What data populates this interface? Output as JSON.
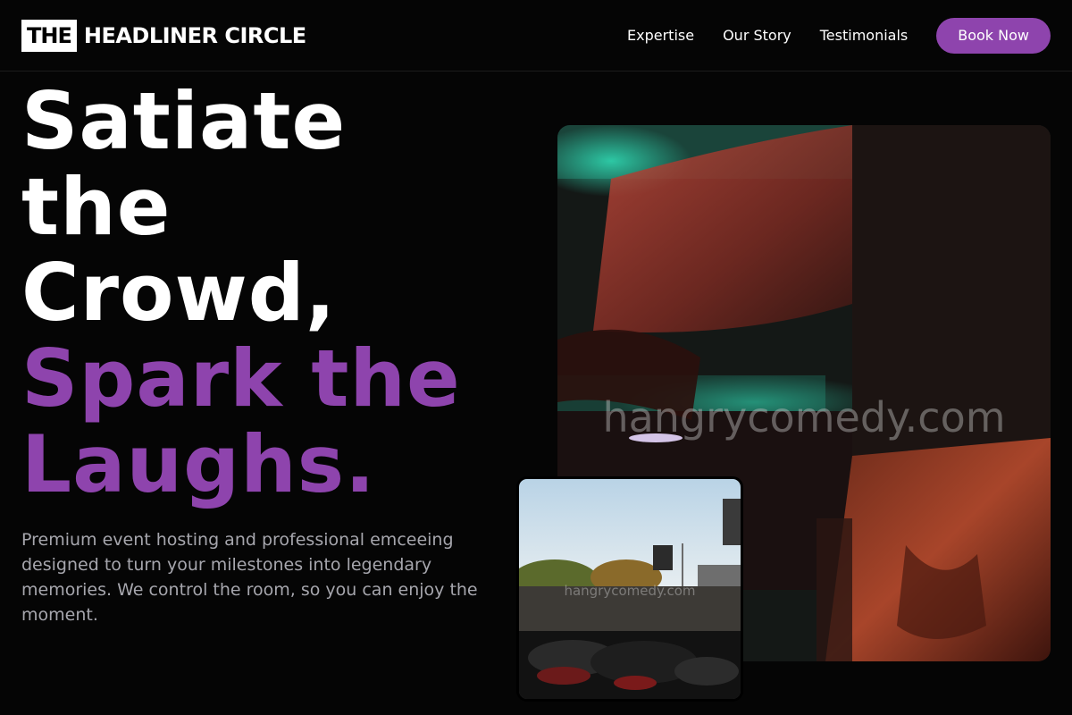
{
  "brand": {
    "logo_box": "THE",
    "logo_text": "HEADLINER CIRCLE"
  },
  "nav": {
    "items": [
      {
        "label": "Expertise"
      },
      {
        "label": "Our Story"
      },
      {
        "label": "Testimonials"
      }
    ],
    "cta_label": "Book Now"
  },
  "hero": {
    "title_lines": [
      "Satiate",
      "the",
      "Crowd,"
    ],
    "accent_lines": [
      "Spark the",
      "Laughs."
    ],
    "subtitle": "Premium event hosting and professional emceeing designed to turn your milestones into legendary memories. We control the room, so you can enjoy the moment."
  },
  "images": {
    "main_watermark": "hangrycomedy.com",
    "inset_watermark": "hangrycomedy.com"
  },
  "colors": {
    "accent": "#8e44ad",
    "background": "#050505",
    "muted_text": "#a6a6ad"
  }
}
